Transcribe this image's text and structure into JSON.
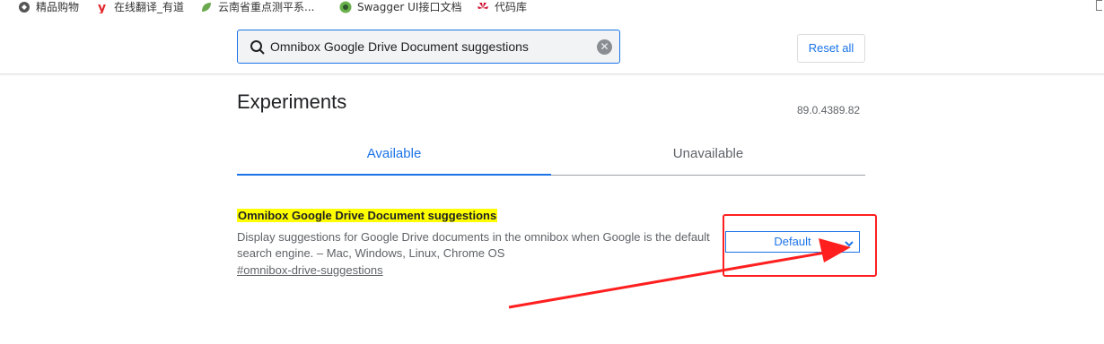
{
  "bookmarks": [
    {
      "label": "精品购物",
      "icon": "shopping-icon"
    },
    {
      "label": "在线翻译_有道",
      "icon": "youdao-icon"
    },
    {
      "label": "云南省重点测平系...",
      "icon": "leaf-icon"
    },
    {
      "label": "Swagger UI接口文档",
      "icon": "swagger-icon"
    },
    {
      "label": "代码库",
      "icon": "huawei-icon"
    }
  ],
  "search": {
    "value": "Omnibox Google Drive Document suggestions",
    "clear_icon": "clear-icon"
  },
  "reset_label": "Reset all",
  "page_title": "Experiments",
  "version": "89.0.4389.82",
  "tabs": [
    {
      "label": "Available",
      "active": true
    },
    {
      "label": "Unavailable",
      "active": false
    }
  ],
  "experiment": {
    "name": "Omnibox Google Drive Document suggestions",
    "description": "Display suggestions for Google Drive documents in the omnibox when Google is the default search engine. – Mac, Windows, Linux, Chrome OS",
    "link": "#omnibox-drive-suggestions",
    "selected_option": "Default"
  },
  "colors": {
    "accent": "#1a73e8",
    "highlight": "#ffff00",
    "annotation": "#ff1f1f"
  }
}
